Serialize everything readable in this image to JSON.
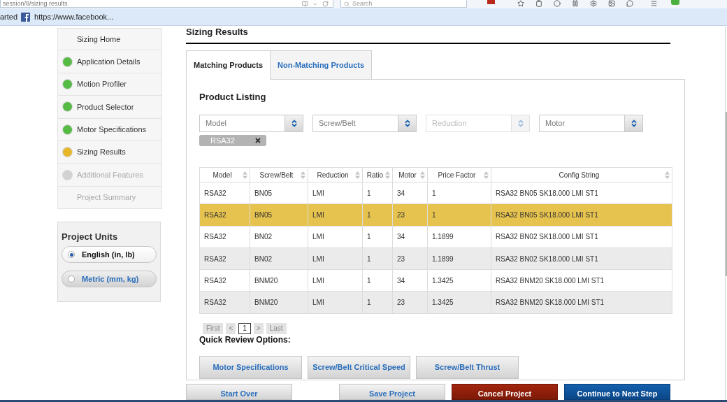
{
  "browser": {
    "address": "session/8/sizing results",
    "search_placeholder": "Search",
    "bookmarks": [
      "arted",
      "https://www.facebook..."
    ]
  },
  "sidebar": {
    "items": [
      {
        "label": "Sizing Home",
        "disabled": false
      },
      {
        "label": "Application Details",
        "color": "#55bb44",
        "disabled": false
      },
      {
        "label": "Motion Profiler",
        "color": "#55bb44",
        "disabled": false
      },
      {
        "label": "Product Selector",
        "color": "#55bb44",
        "disabled": false
      },
      {
        "label": "Motor Specifications",
        "color": "#55bb44",
        "disabled": false
      },
      {
        "label": "Sizing Results",
        "color": "#e8b62a",
        "disabled": false
      },
      {
        "label": "Additional Features",
        "color": "#d2d2d2",
        "disabled": true
      },
      {
        "label": "Project Summary",
        "disabled": true
      }
    ]
  },
  "project_units": {
    "title": "Project Units",
    "options": [
      {
        "label": "English (in, lb)",
        "selected": true
      },
      {
        "label": "Metric (mm, kg)",
        "selected": false
      }
    ]
  },
  "page": {
    "title": "Sizing Results"
  },
  "tabs": [
    {
      "label": "Matching Products",
      "selected": true
    },
    {
      "label": "Non-Matching Products",
      "selected": false
    }
  ],
  "product_listing": {
    "title": "Product Listing",
    "filters": [
      {
        "placeholder": "Model",
        "disabled": false
      },
      {
        "placeholder": "Screw/Belt",
        "disabled": false
      },
      {
        "placeholder": "Reduction",
        "disabled": true
      },
      {
        "placeholder": "Motor",
        "disabled": false
      }
    ],
    "chips": [
      "RSA32"
    ]
  },
  "table": {
    "columns": [
      "Model",
      "Screw/Belt",
      "Reduction",
      "Ratio",
      "Motor",
      "Price Factor",
      "Config String"
    ],
    "rows": [
      {
        "selected": false,
        "cells": [
          "RSA32",
          "BN05",
          "LMI",
          "1",
          "34",
          "1",
          "RSA32 BN05 SK18.000 LMI ST1"
        ]
      },
      {
        "selected": true,
        "cells": [
          "RSA32",
          "BN05",
          "LMI",
          "1",
          "23",
          "1",
          "RSA32 BN05 SK18.000 LMI ST1"
        ]
      },
      {
        "selected": false,
        "cells": [
          "RSA32",
          "BN02",
          "LMI",
          "1",
          "34",
          "1.1899",
          "RSA32 BN02 SK18.000 LMI ST1"
        ]
      },
      {
        "selected": false,
        "cells": [
          "RSA32",
          "BN02",
          "LMI",
          "1",
          "23",
          "1.1899",
          "RSA32 BN02 SK18.000 LMI ST1"
        ]
      },
      {
        "selected": false,
        "cells": [
          "RSA32",
          "BNM20",
          "LMI",
          "1",
          "34",
          "1.3425",
          "RSA32 BNM20 SK18.000 LMI ST1"
        ]
      },
      {
        "selected": false,
        "cells": [
          "RSA32",
          "BNM20",
          "LMI",
          "1",
          "23",
          "1.3425",
          "RSA32 BNM20 SK18.000 LMI ST1"
        ]
      }
    ]
  },
  "pagination": {
    "first": "First",
    "previous": "<",
    "pages": [
      {
        "label": "1",
        "selected": true
      }
    ],
    "next": ">",
    "last": "Last"
  },
  "quick_review": {
    "title": "Quick Review Options:",
    "buttons": [
      "Motor Specifications",
      "Screw/Belt Critical Speed",
      "Screw/Belt Thrust"
    ]
  },
  "actions": [
    {
      "label": "Start Over",
      "kind": "secondary"
    },
    {
      "label": "Save Project",
      "kind": "secondary"
    },
    {
      "label": "Cancel Project",
      "kind": "danger"
    },
    {
      "label": "Continue to Next Step",
      "kind": "primary"
    }
  ]
}
